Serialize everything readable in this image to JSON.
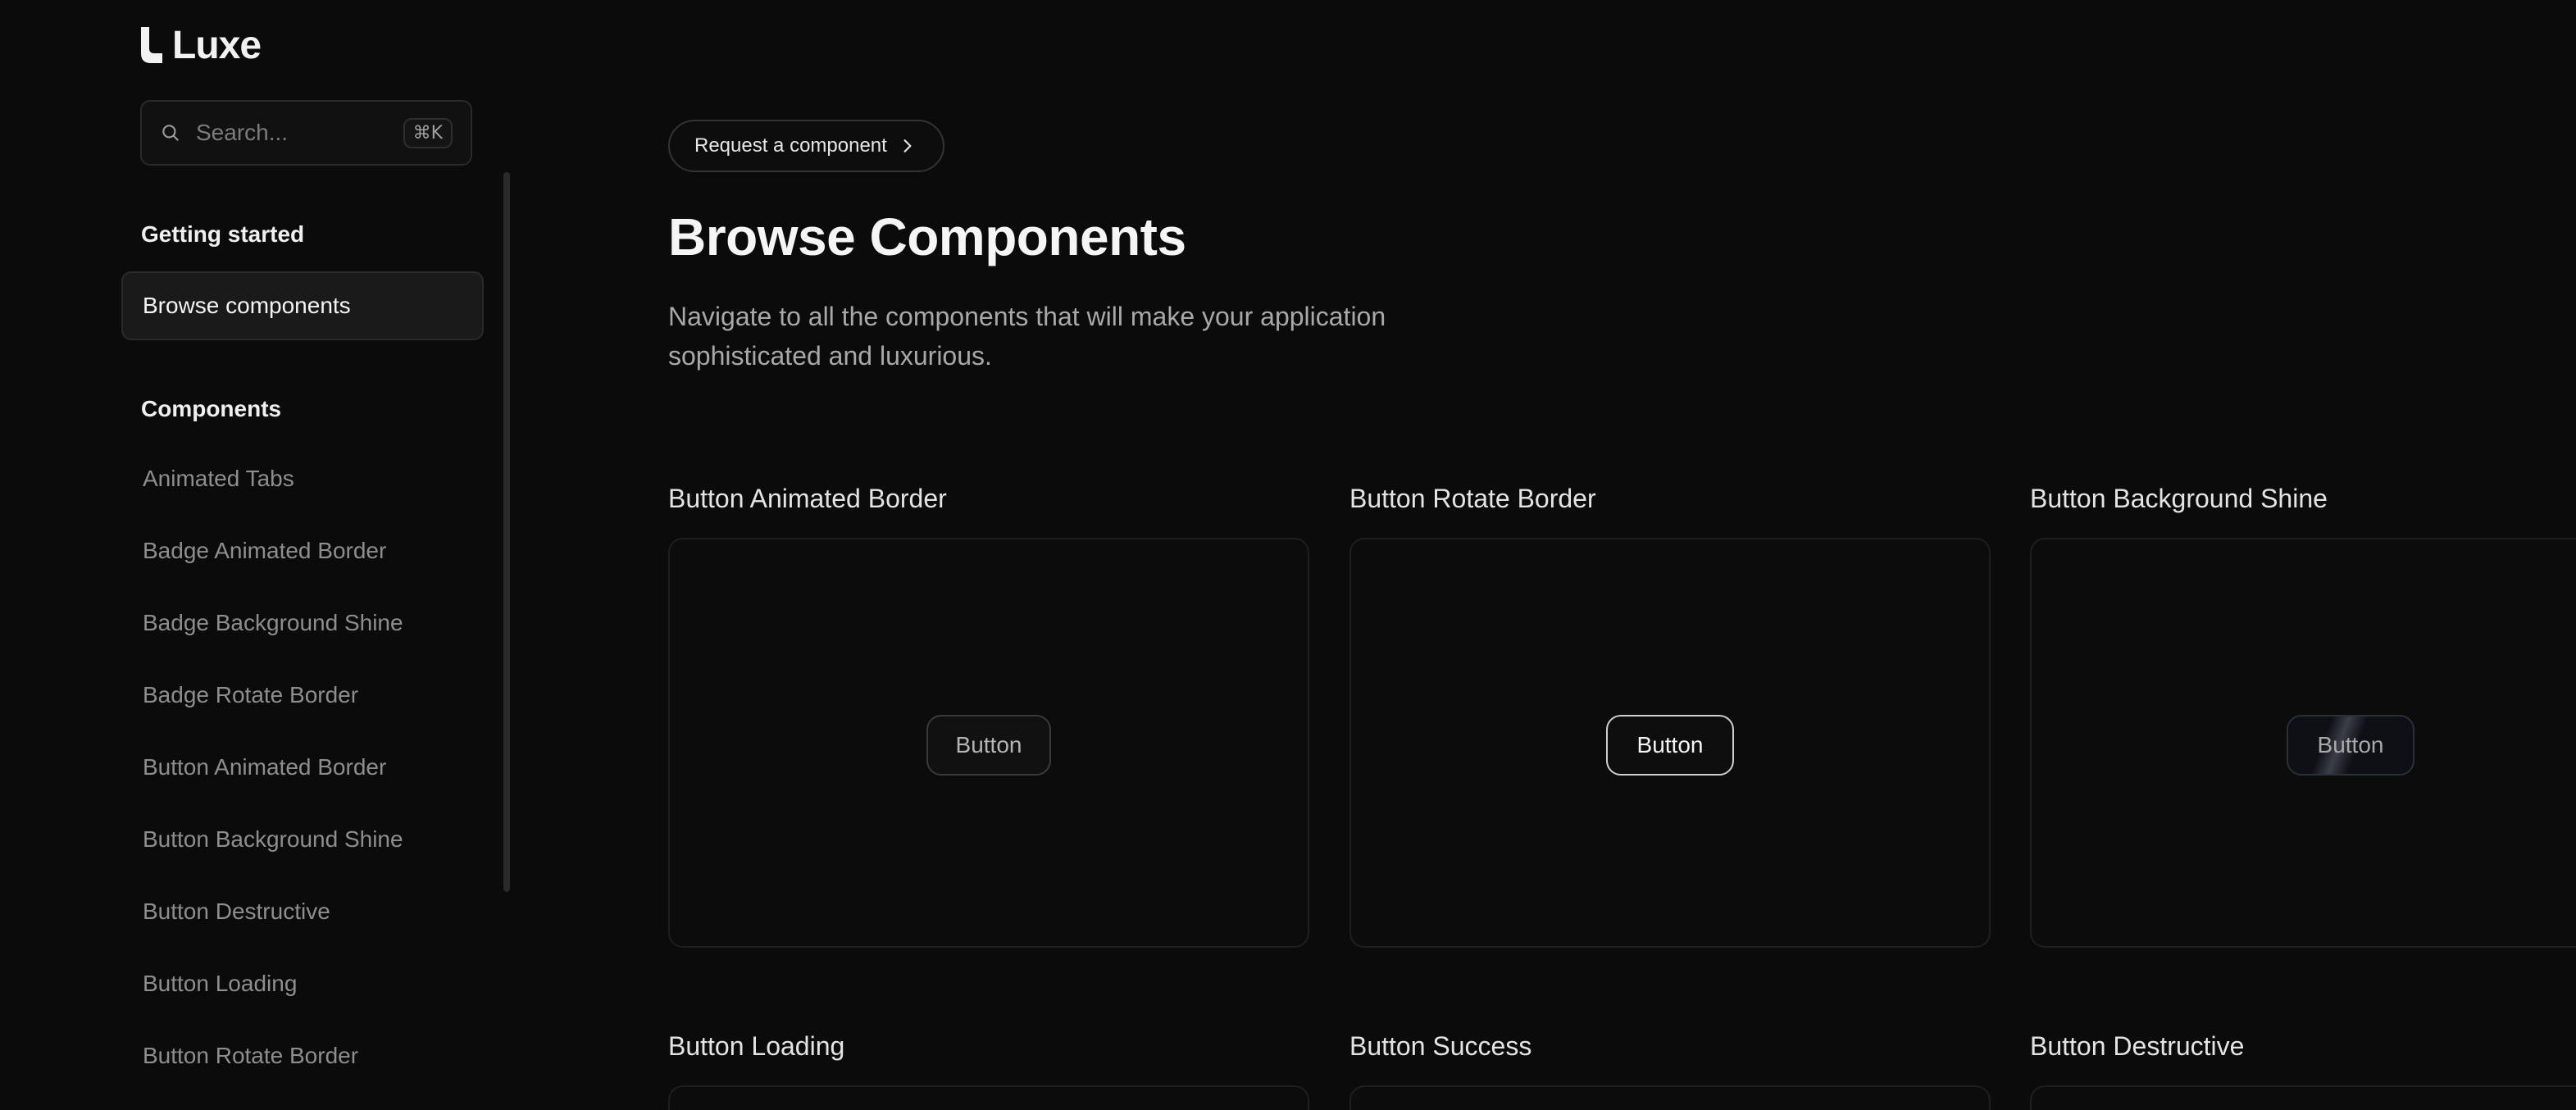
{
  "app": {
    "name": "Luxe"
  },
  "search": {
    "placeholder": "Search...",
    "shortcut": "⌘K"
  },
  "sidebar": {
    "getting_started_heading": "Getting started",
    "active_item": "Browse components",
    "components_heading": "Components",
    "items": [
      "Animated Tabs",
      "Badge Animated Border",
      "Badge Background Shine",
      "Badge Rotate Border",
      "Button Animated Border",
      "Button Background Shine",
      "Button Destructive",
      "Button Loading",
      "Button Rotate Border"
    ]
  },
  "main": {
    "request_label": "Request a component",
    "title": "Browse Components",
    "description": "Navigate to all the components that will make your application sophisticated and luxurious.",
    "cards": [
      {
        "title": "Button Animated Border",
        "button_label": "Button"
      },
      {
        "title": "Button Rotate Border",
        "button_label": "Button"
      },
      {
        "title": "Button Background Shine",
        "button_label": "Button"
      },
      {
        "title": "Button Loading"
      },
      {
        "title": "Button Success"
      },
      {
        "title": "Button Destructive"
      }
    ]
  },
  "colors": {
    "background": "#0b0b0b",
    "text": "#e8e8e8",
    "muted": "#8e8e8e",
    "border": "#2a2a2a"
  }
}
